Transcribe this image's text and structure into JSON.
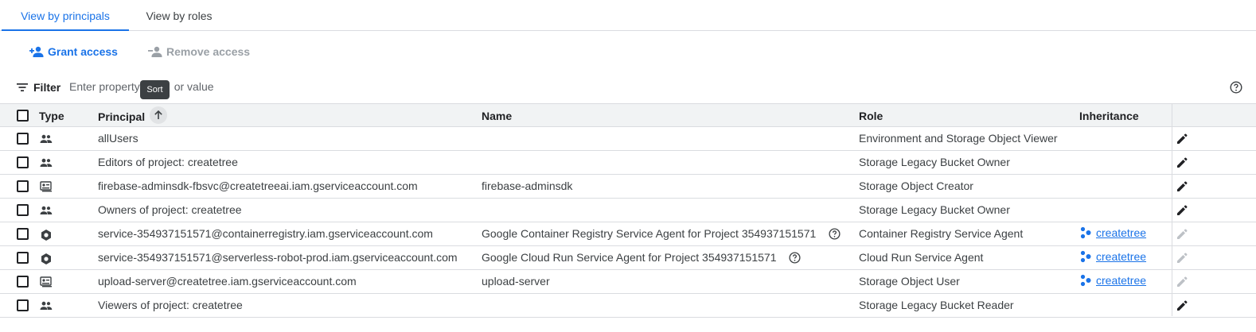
{
  "tabs": [
    {
      "label": "View by principals",
      "active": true
    },
    {
      "label": "View by roles",
      "active": false
    }
  ],
  "actions": {
    "grant_label": "Grant access",
    "remove_label": "Remove access"
  },
  "filter": {
    "label": "Filter",
    "placeholder_before": "Enter property",
    "placeholder_after": "or value",
    "tooltip": "Sort",
    "help_icon": "help-circle-icon"
  },
  "columns": {
    "type": "Type",
    "principal": "Principal",
    "name": "Name",
    "role": "Role",
    "inheritance": "Inheritance"
  },
  "rows": [
    {
      "type_icon": "group-icon",
      "principal": "allUsers",
      "name": "",
      "role": "Environment and Storage Object Viewer",
      "inheritance": "",
      "editable": true
    },
    {
      "type_icon": "group-icon",
      "principal": "Editors of project: createtree",
      "name": "",
      "role": "Storage Legacy Bucket Owner",
      "inheritance": "",
      "editable": true
    },
    {
      "type_icon": "service-account-icon",
      "principal": "firebase-adminsdk-fbsvc@createtreeai.iam.gserviceaccount.com",
      "name": "firebase-adminsdk",
      "role": "Storage Object Creator",
      "inheritance": "",
      "editable": true
    },
    {
      "type_icon": "group-icon",
      "principal": "Owners of project: createtree",
      "name": "",
      "role": "Storage Legacy Bucket Owner",
      "inheritance": "",
      "editable": true
    },
    {
      "type_icon": "service-agent-icon",
      "principal": "service-354937151571@containerregistry.iam.gserviceaccount.com",
      "name": "Google Container Registry Service Agent for Project 354937151571",
      "role": "Container Registry Service Agent",
      "inheritance": "createtree",
      "editable": false
    },
    {
      "type_icon": "service-agent-icon",
      "principal": "service-354937151571@serverless-robot-prod.iam.gserviceaccount.com",
      "name": "Google Cloud Run Service Agent for Project 354937151571",
      "role": "Cloud Run Service Agent",
      "inheritance": "createtree",
      "editable": false
    },
    {
      "type_icon": "service-account-icon",
      "principal": "upload-server@createtree.iam.gserviceaccount.com",
      "name": "upload-server",
      "role": "Storage Object User",
      "inheritance": "createtree",
      "editable": false
    },
    {
      "type_icon": "group-icon",
      "principal": "Viewers of project: createtree",
      "name": "",
      "role": "Storage Legacy Bucket Reader",
      "inheritance": "",
      "editable": true
    }
  ],
  "colors": {
    "accent": "#1a73e8",
    "disabled": "#9aa0a6",
    "header_bg": "#f1f3f4",
    "border": "#dadce0"
  }
}
